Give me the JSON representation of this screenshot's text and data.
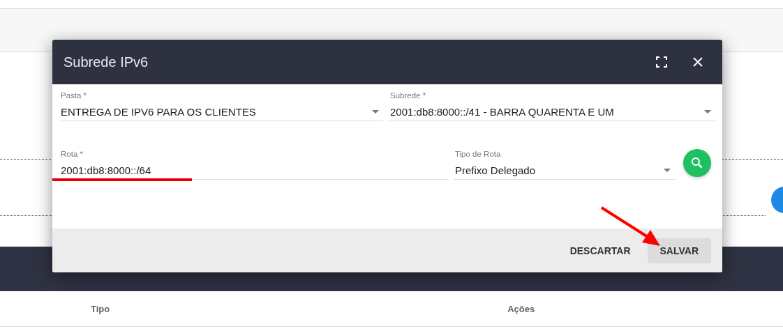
{
  "dialog": {
    "title": "Subrede IPv6",
    "rows": [
      [
        {
          "kind": "select",
          "label": "Pasta *",
          "value": "ENTREGA DE IPV6 PARA OS CLIENTES"
        },
        {
          "kind": "select",
          "label": "Subrede *",
          "value": "2001:db8:8000::/41 - BARRA QUARENTA E UM"
        }
      ],
      [
        {
          "kind": "text",
          "label": "Rota *",
          "value": "2001:db8:8000::/64"
        },
        {
          "kind": "select",
          "label": "Tipo de Rota",
          "value": "Prefixo Delegado"
        }
      ]
    ],
    "buttons": [
      {
        "label": "DESCARTAR",
        "kind": "flat"
      },
      {
        "label": "SALVAR",
        "kind": "raised"
      }
    ]
  },
  "table": {
    "columns": [
      "Tipo",
      "Ações"
    ]
  }
}
